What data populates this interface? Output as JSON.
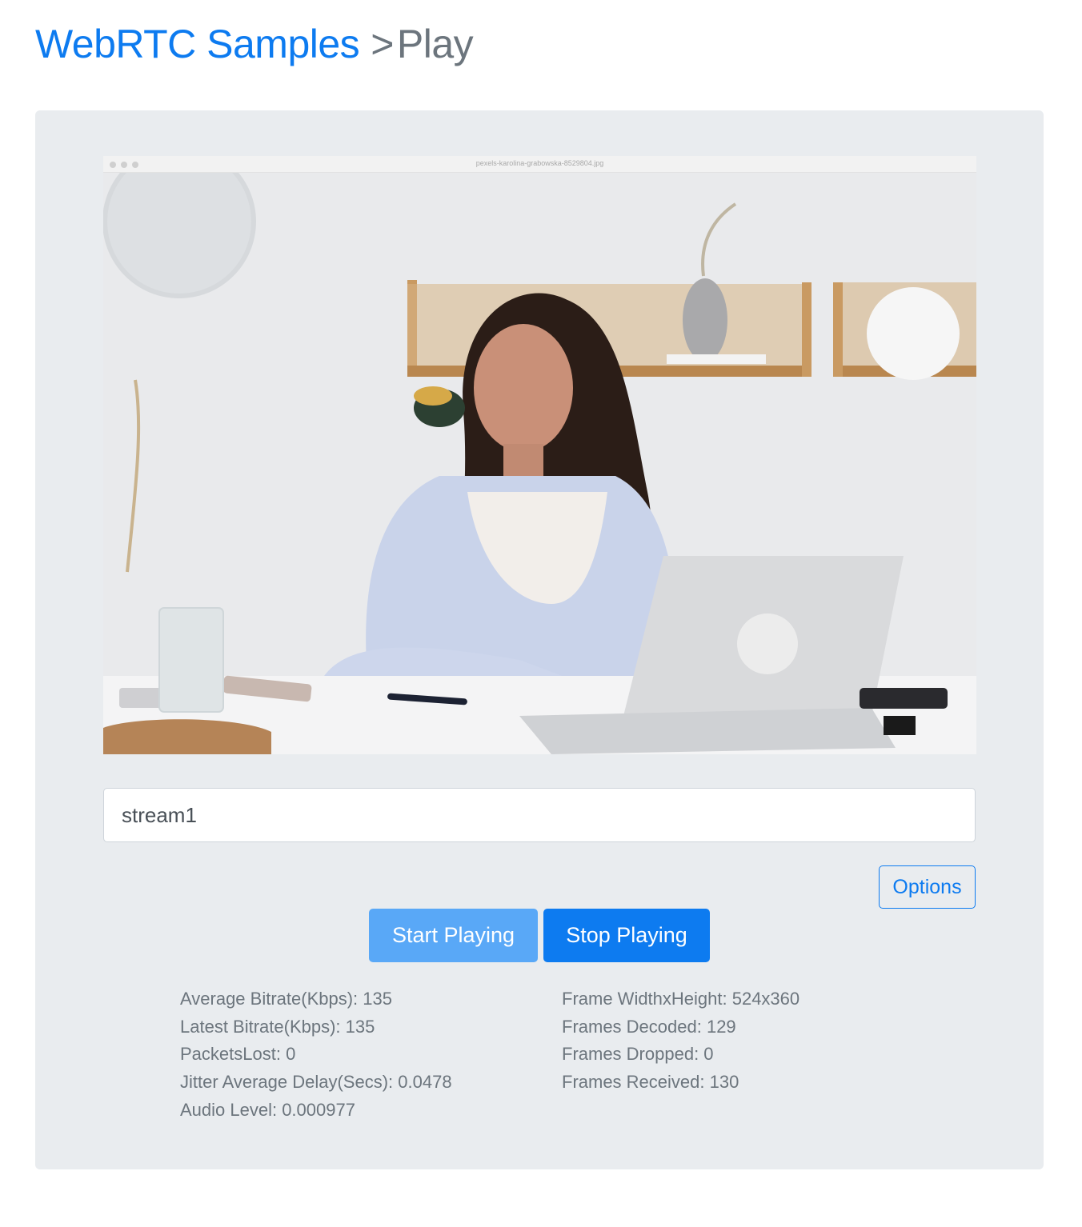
{
  "header": {
    "home_link": "WebRTC Samples",
    "separator": ">",
    "current": "Play"
  },
  "video": {
    "window_title": "pexels-karolina-grabowska-8529804.jpg"
  },
  "stream_input": {
    "value": "stream1"
  },
  "buttons": {
    "options": "Options",
    "start": "Start Playing",
    "stop": "Stop Playing"
  },
  "stats": {
    "left": [
      "Average Bitrate(Kbps): 135",
      "Latest Bitrate(Kbps): 135",
      "PacketsLost: 0",
      "Jitter Average Delay(Secs): 0.0478",
      "Audio Level: 0.000977"
    ],
    "right": [
      "Frame WidthxHeight: 524x360",
      "Frames Decoded: 129",
      "Frames Dropped: 0",
      "Frames Received: 130"
    ]
  },
  "colors": {
    "primary": "#0d7bf0",
    "primary_light": "#59a8f7",
    "panel_bg": "#e9ecef",
    "muted_text": "#6c757d"
  }
}
